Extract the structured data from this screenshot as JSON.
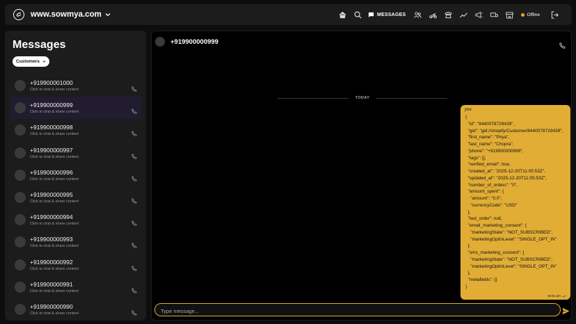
{
  "header": {
    "site_name": "www.sowmya.com",
    "messages_label": "MESSAGES",
    "status_text": "Offline",
    "status_color": "#f5a623",
    "icons": [
      "home-icon",
      "search-icon",
      "chat-icon",
      "users-icon",
      "moped-icon",
      "phone-icon",
      "chart-icon",
      "megaphone-icon",
      "truck-icon",
      "store-icon",
      "logout-icon"
    ]
  },
  "sidebar": {
    "title": "Messages",
    "filter_label": "Customers",
    "contacts": [
      {
        "name": "+919900001000",
        "sub": "Click to chat & share content"
      },
      {
        "name": "+919900000999",
        "sub": "Click to chat & share content"
      },
      {
        "name": "+919900000998",
        "sub": "Click to chat & share content"
      },
      {
        "name": "+919900000997",
        "sub": "Click to chat & share content"
      },
      {
        "name": "+919900000996",
        "sub": "Click to chat & share content"
      },
      {
        "name": "+919900000995",
        "sub": "Click to chat & share content"
      },
      {
        "name": "+919900000994",
        "sub": "Click to chat & share content"
      },
      {
        "name": "+919900000993",
        "sub": "Click to chat & share content"
      },
      {
        "name": "+919900000992",
        "sub": "Click to chat & share content"
      },
      {
        "name": "+919900000991",
        "sub": "Click to chat & share content"
      },
      {
        "name": "+919900000990",
        "sub": "Click to chat & share content"
      }
    ],
    "active_index": 1
  },
  "chat": {
    "contact_name": "+919900000999",
    "date_divider": "TODAY",
    "message": {
      "from": "you",
      "body": "{\n  \"id\": \"8440078729439\",\n  \"gid\": \"gid://shopify/Customer/8440078729439\",\n  \"first_name\": \"Priya\",\n  \"last_name\": \"Chopra\",\n  \"phone\": \"+919900000999\",\n  \"tags\": [],\n  \"verified_email\": true,\n  \"created_at\": \"2025-12-20T11:05:53Z\",\n  \"updated_at\": \"2025-12-20T11:05:53Z\",\n  \"number_of_orders\": \"0\",\n  \"amount_spent\": {\n    \"amount\": \"0.0\",\n    \"currencyCode\": \"USD\"\n  },\n  \"last_order\": null,\n  \"email_marketing_consent\": {\n    \"marketingState\": \"NOT_SUBSCRIBED\",\n    \"marketingOptInLevel\": \"SINGLE_OPT_IN\"\n  },\n  \"sms_marketing_consent\": {\n    \"marketingState\": \"NOT_SUBSCRIBED\",\n    \"marketingOptInLevel\": \"SINGLE_OPT_IN\"\n  },\n  \"metafields\": {}\n}",
      "time": "04:51 pm",
      "bubble_color": "#e1ad35"
    },
    "composer_placeholder": "Type message..."
  }
}
